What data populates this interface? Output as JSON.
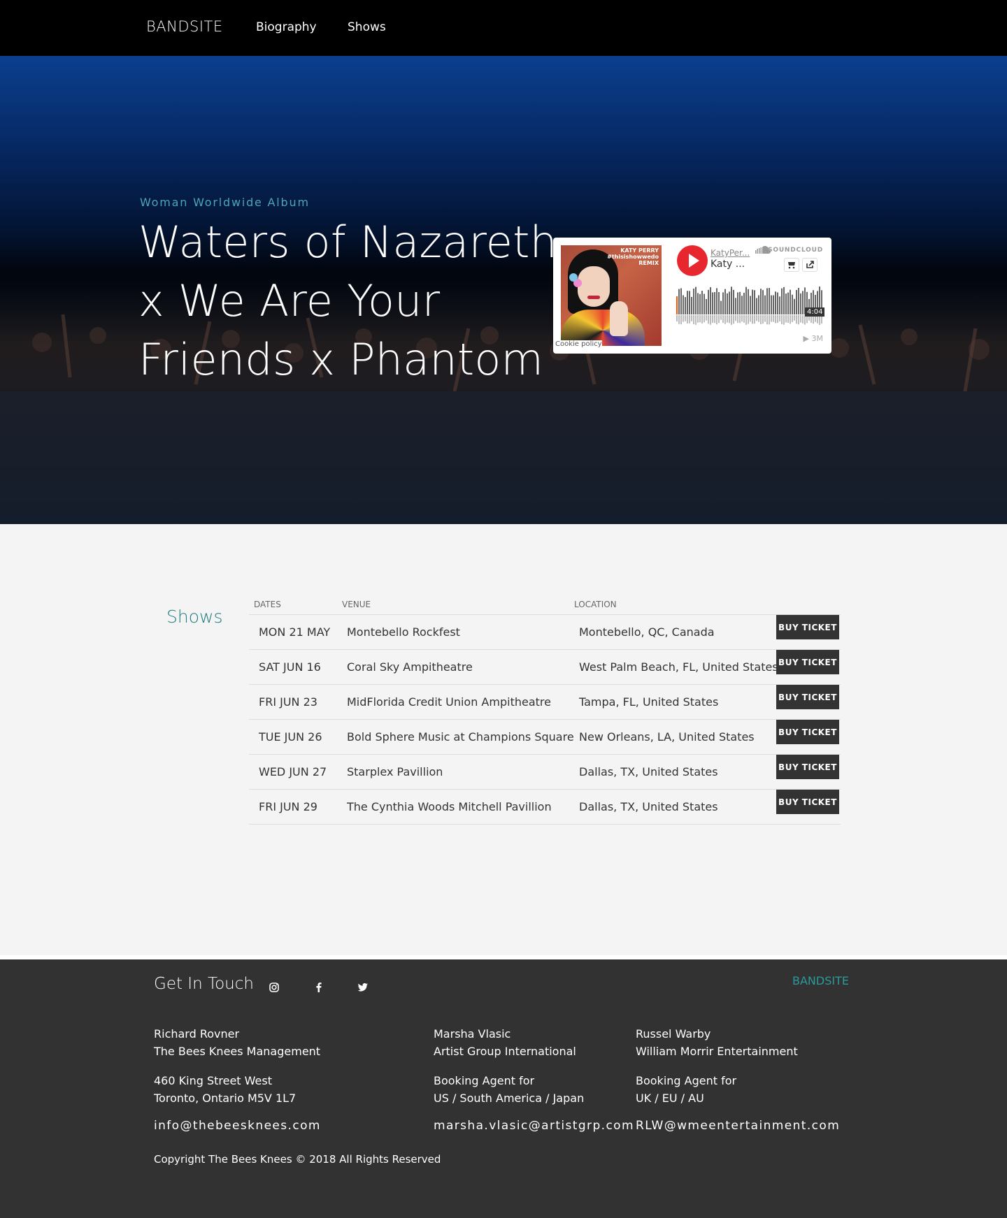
{
  "nav": {
    "brand": "BANDSITE",
    "links": [
      "Biography",
      "Shows"
    ]
  },
  "hero": {
    "subtitle": "Woman Worldwide Album",
    "title": "Waters of Nazareth x We Are Your Friends x Phantom"
  },
  "soundcloud": {
    "user": "KatyPer...",
    "track": "Katy ...",
    "brand": "SOUNDCLOUD",
    "duration": "4:04",
    "plays": "3M",
    "cookie": "Cookie policy",
    "artwork_text": [
      "KATY PERRY",
      "#thisishowwedo",
      "REMIX"
    ]
  },
  "shows": {
    "heading": "Shows",
    "columns": [
      "DATES",
      "VENUE",
      "LOCATION"
    ],
    "button_label": "BUY TICKET",
    "rows": [
      {
        "date": "MON 21 MAY",
        "venue": "Montebello Rockfest",
        "location": "Montebello, QC, Canada"
      },
      {
        "date": "SAT JUN 16",
        "venue": "Coral Sky Ampitheatre",
        "location": "West Palm Beach, FL, United States"
      },
      {
        "date": "FRI JUN 23",
        "venue": "MidFlorida Credit Union Ampitheatre",
        "location": "Tampa, FL, United States"
      },
      {
        "date": "TUE JUN 26",
        "venue": "Bold Sphere Music at Champions Square",
        "location": "New Orleans, LA, United States"
      },
      {
        "date": "WED JUN 27",
        "venue": "Starplex Pavillion",
        "location": "Dallas, TX, United States"
      },
      {
        "date": "FRI JUN 29",
        "venue": "The Cynthia Woods Mitchell Pavillion",
        "location": "Dallas, TX, United States"
      }
    ]
  },
  "footer": {
    "heading": "Get In Touch",
    "brand": "BANDSITE",
    "social_icons": [
      "instagram-icon",
      "facebook-icon",
      "twitter-icon"
    ],
    "contacts": [
      {
        "name": "Richard Rovner",
        "org": "The Bees Knees Management",
        "line1": "460 King Street West",
        "line2": "Toronto, Ontario M5V 1L7",
        "email": "info@thebeesknees.com"
      },
      {
        "name": "Marsha Vlasic",
        "org": "Artist Group International",
        "line1": "Booking Agent for",
        "line2": "US / South America / Japan",
        "email": "marsha.vlasic@artistgrp.com"
      },
      {
        "name": "Russel Warby",
        "org": "William Morrir Entertainment",
        "line1": "Booking Agent for",
        "line2": "UK / EU / AU",
        "email": "RLW@wmeentertainment.com"
      }
    ],
    "copyright": "Copyright The Bees Knees © 2018 All Rights Reserved"
  },
  "colors": {
    "accent": "#2b9a9c",
    "hero_top": "#0b3f8e",
    "footer_bg": "#323232",
    "button_bg": "#333333",
    "soundcloud_orange": "#e8262d"
  }
}
